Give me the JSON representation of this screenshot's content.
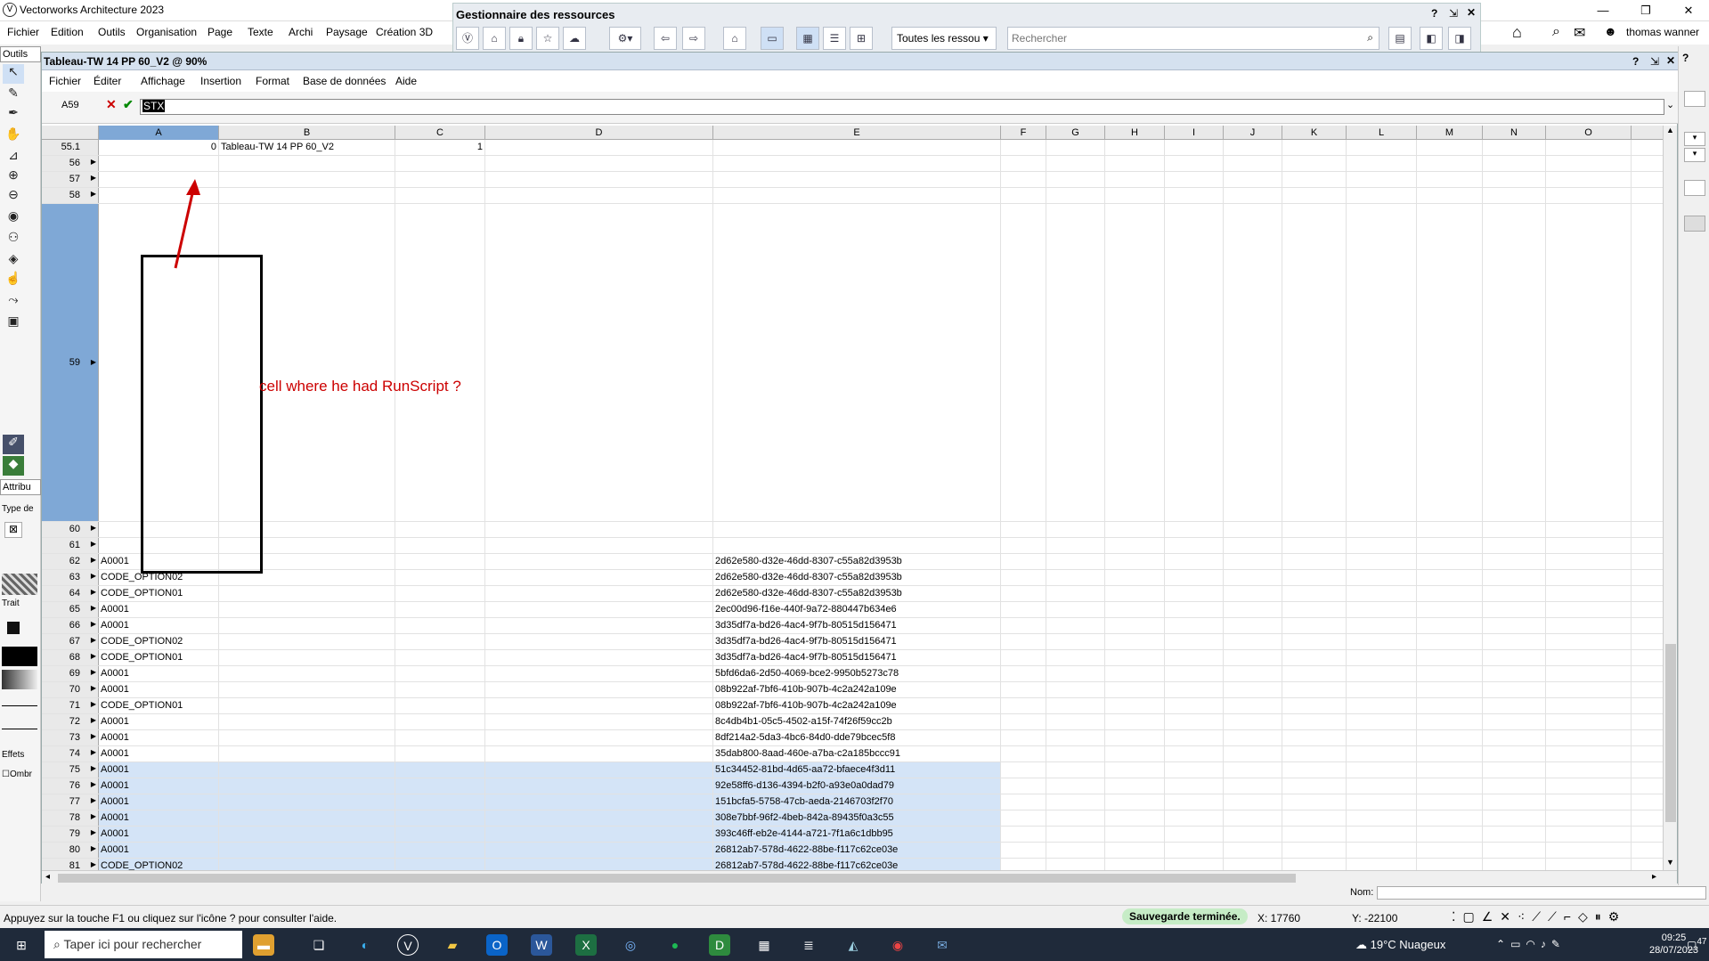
{
  "app": {
    "title": "Vectorworks Architecture 2023",
    "logo": "V"
  },
  "menu": [
    "Fichier",
    "Edition",
    "Outils",
    "Organisation",
    "Page",
    "Texte",
    "Archi",
    "Paysage",
    "Création 3D"
  ],
  "resource_manager": {
    "title": "Gestionnaire des ressources",
    "filter": "Toutes les ressou",
    "search_placeholder": "Rechercher",
    "help": "?"
  },
  "user": {
    "name": "thomas wanner"
  },
  "tools_palette": {
    "tab": "Outils",
    "attr_tab": "Attribu",
    "type_label": "Type de",
    "trait_label": "Trait",
    "effects_label": "Effets",
    "shadow_label": "Ombr"
  },
  "sheet": {
    "title": "Tableau-TW 14 PP 60_V2 @ 90%",
    "menu": [
      "Fichier",
      "Éditer",
      "Affichage",
      "Insertion",
      "Format",
      "Base de données",
      "Aide"
    ],
    "cell_ref": "A59",
    "formula_value": "STX",
    "columns": [
      "A",
      "B",
      "C",
      "D",
      "E",
      "F",
      "G",
      "H",
      "I",
      "J",
      "K",
      "L",
      "M",
      "N",
      "O"
    ],
    "rows": [
      {
        "n": "55.1",
        "a": "0",
        "b": "Tableau-TW 14 PP 60_V2",
        "c": "1",
        "e": ""
      },
      {
        "n": "56",
        "a": "",
        "b": "",
        "c": "",
        "e": ""
      },
      {
        "n": "57",
        "a": "",
        "b": "",
        "c": "",
        "e": ""
      },
      {
        "n": "58",
        "a": "",
        "b": "",
        "c": "",
        "e": ""
      },
      {
        "n": "59",
        "a": "",
        "b": "",
        "c": "",
        "e": ""
      },
      {
        "n": "60",
        "a": "",
        "b": "",
        "c": "",
        "e": ""
      },
      {
        "n": "61",
        "a": "",
        "b": "",
        "c": "",
        "e": ""
      },
      {
        "n": "62",
        "a": "A0001",
        "b": "",
        "c": "",
        "e": "2d62e580-d32e-46dd-8307-c55a82d3953b"
      },
      {
        "n": "63",
        "a": "CODE_OPTION02",
        "b": "",
        "c": "",
        "e": "2d62e580-d32e-46dd-8307-c55a82d3953b"
      },
      {
        "n": "64",
        "a": "CODE_OPTION01",
        "b": "",
        "c": "",
        "e": "2d62e580-d32e-46dd-8307-c55a82d3953b"
      },
      {
        "n": "65",
        "a": "A0001",
        "b": "",
        "c": "",
        "e": "2ec00d96-f16e-440f-9a72-880447b634e6"
      },
      {
        "n": "66",
        "a": "A0001",
        "b": "",
        "c": "",
        "e": "3d35df7a-bd26-4ac4-9f7b-80515d156471"
      },
      {
        "n": "67",
        "a": "CODE_OPTION02",
        "b": "",
        "c": "",
        "e": "3d35df7a-bd26-4ac4-9f7b-80515d156471"
      },
      {
        "n": "68",
        "a": "CODE_OPTION01",
        "b": "",
        "c": "",
        "e": "3d35df7a-bd26-4ac4-9f7b-80515d156471"
      },
      {
        "n": "69",
        "a": "A0001",
        "b": "",
        "c": "",
        "e": "5bfd6da6-2d50-4069-bce2-9950b5273c78"
      },
      {
        "n": "70",
        "a": "A0001",
        "b": "",
        "c": "",
        "e": "08b922af-7bf6-410b-907b-4c2a242a109e"
      },
      {
        "n": "71",
        "a": "CODE_OPTION01",
        "b": "",
        "c": "",
        "e": "08b922af-7bf6-410b-907b-4c2a242a109e"
      },
      {
        "n": "72",
        "a": "A0001",
        "b": "",
        "c": "",
        "e": "8c4db4b1-05c5-4502-a15f-74f26f59cc2b"
      },
      {
        "n": "73",
        "a": "A0001",
        "b": "",
        "c": "",
        "e": "8df214a2-5da3-4bc6-84d0-dde79bcec5f8"
      },
      {
        "n": "74",
        "a": "A0001",
        "b": "",
        "c": "",
        "e": "35dab800-8aad-460e-a7ba-c2a185bccc91"
      },
      {
        "n": "75",
        "a": "A0001",
        "b": "",
        "c": "",
        "e": "51c34452-81bd-4d65-aa72-bfaece4f3d11"
      },
      {
        "n": "76",
        "a": "A0001",
        "b": "",
        "c": "",
        "e": "92e58ff6-d136-4394-b2f0-a93e0a0dad79"
      },
      {
        "n": "77",
        "a": "A0001",
        "b": "",
        "c": "",
        "e": "151bcfa5-5758-47cb-aeda-2146703f2f70"
      },
      {
        "n": "78",
        "a": "A0001",
        "b": "",
        "c": "",
        "e": "308e7bbf-96f2-4beb-842a-89435f0a3c55"
      },
      {
        "n": "79",
        "a": "A0001",
        "b": "",
        "c": "",
        "e": "393c46ff-eb2e-4144-a721-7f1a6c1dbb95"
      },
      {
        "n": "80",
        "a": "A0001",
        "b": "",
        "c": "",
        "e": "26812ab7-578d-4622-88be-f117c62ce03e"
      },
      {
        "n": "81",
        "a": "CODE_OPTION02",
        "b": "",
        "c": "",
        "e": "26812ab7-578d-4622-88be-f117c62ce03e"
      }
    ]
  },
  "annotation": {
    "text": "cell where he had RunScript ?"
  },
  "nom_label": "Nom:",
  "status": {
    "help": "Appuyez sur la touche F1 ou cliquez sur l'icône ? pour consulter l'aide.",
    "save": "Sauvegarde terminée.",
    "x": "X:  17760",
    "y": "Y:  -22100"
  },
  "taskbar": {
    "search": "Taper ici pour rechercher",
    "weather": "19°C  Nuageux",
    "time": "09:25",
    "date": "28/07/2023",
    "notifications": "47"
  },
  "colors": {
    "accent": "#7fa8d6",
    "highlight": "#d4e4f7",
    "annotation": "#cc0000"
  }
}
